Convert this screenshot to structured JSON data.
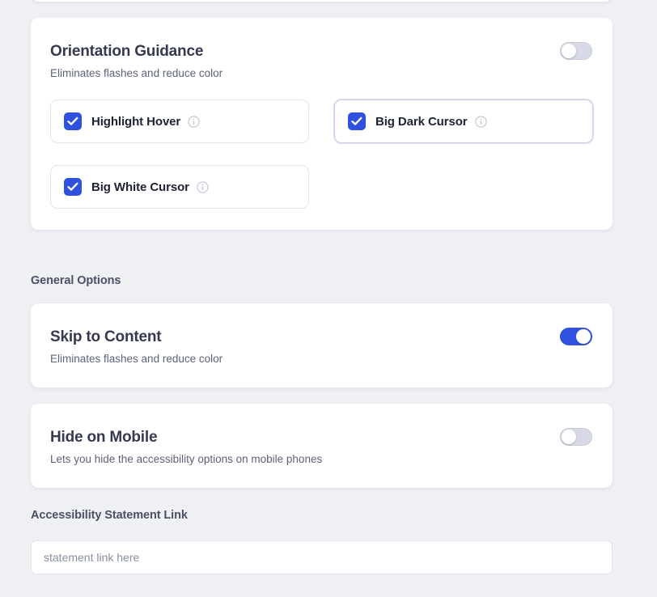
{
  "background_color": "#eef0f4",
  "accent_color": "#2f51dd",
  "orientation_section": {
    "title": "Orientation Guidance",
    "subtitle": "Eliminates flashes and reduce color",
    "toggle": {
      "name": "orientation-guidance-toggle",
      "state": "off"
    },
    "options": [
      {
        "label": "Highlight Hover",
        "checked": true,
        "info_icon": "info-icon",
        "highlighted": false
      },
      {
        "label": "Big Dark Cursor",
        "checked": true,
        "info_icon": "info-icon",
        "highlighted": true
      },
      {
        "label": "Big White Cursor",
        "checked": true,
        "info_icon": "info-icon",
        "highlighted": false
      }
    ]
  },
  "general_options": {
    "heading": "General Options",
    "rows": [
      {
        "title": "Skip to Content",
        "subtitle": "Eliminates flashes and reduce color",
        "toggle_state": "on"
      },
      {
        "title": "Hide on Mobile",
        "subtitle": "Lets you hide the accessibility options on mobile phones",
        "toggle_state": "off"
      }
    ]
  },
  "statement_link": {
    "label": "Accessibility Statement Link",
    "placeholder": "statement link here",
    "value": ""
  }
}
